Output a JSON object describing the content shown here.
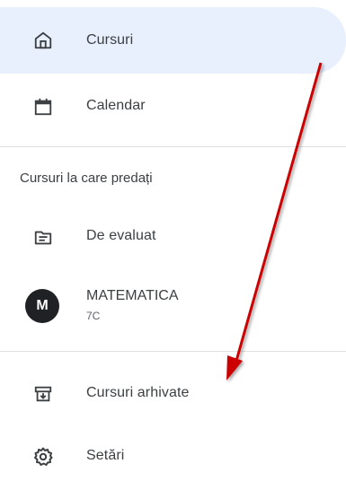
{
  "nav": {
    "courses": "Cursuri",
    "calendar": "Calendar"
  },
  "teaching": {
    "section_title": "Cursuri la care predați",
    "to_review": "De evaluat",
    "class": {
      "avatar_letter": "M",
      "name": "MATEMATICA",
      "section": "7C"
    }
  },
  "bottom": {
    "archived": "Cursuri arhivate",
    "settings": "Setări"
  },
  "colors": {
    "active_bg": "#e8f0fe",
    "annotation_arrow": "#cc0000"
  }
}
